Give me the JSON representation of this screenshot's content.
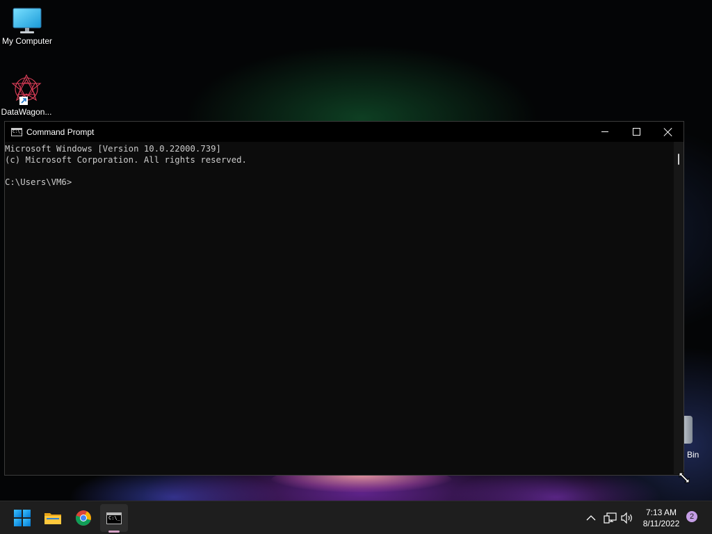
{
  "desktop": {
    "icons": [
      {
        "label": "My Computer",
        "icon": "monitor-icon"
      },
      {
        "label": "DataWagon...",
        "icon": "datawagon-icon"
      },
      {
        "label": "Bin",
        "icon": "recycle-bin-icon"
      }
    ]
  },
  "window": {
    "title": "Command Prompt",
    "icon": "cmd-icon",
    "icon_glyph": "C:\\_",
    "controls": [
      "minimize-icon",
      "maximize-icon",
      "close-icon"
    ],
    "console_lines": [
      "Microsoft Windows [Version 10.0.22000.739]",
      "(c) Microsoft Corporation. All rights reserved.",
      "",
      "C:\\Users\\VM6>"
    ],
    "colors": {
      "console_bg": "#0c0c0c",
      "console_text": "#cccccc",
      "title_bg": "#000000"
    }
  },
  "taskbar": {
    "pinned": [
      {
        "name": "start-button",
        "icon": "windows-logo-icon"
      },
      {
        "name": "file-explorer",
        "icon": "folder-icon"
      },
      {
        "name": "chrome",
        "icon": "chrome-icon"
      },
      {
        "name": "command-prompt",
        "icon": "cmd-icon",
        "glyph": "C:\\_",
        "active": true
      }
    ],
    "tray": {
      "icons": [
        "chevron-up-icon",
        "network-icon",
        "volume-icon"
      ],
      "time": "7:13 AM",
      "date": "8/11/2022",
      "notification_count": "2"
    }
  }
}
